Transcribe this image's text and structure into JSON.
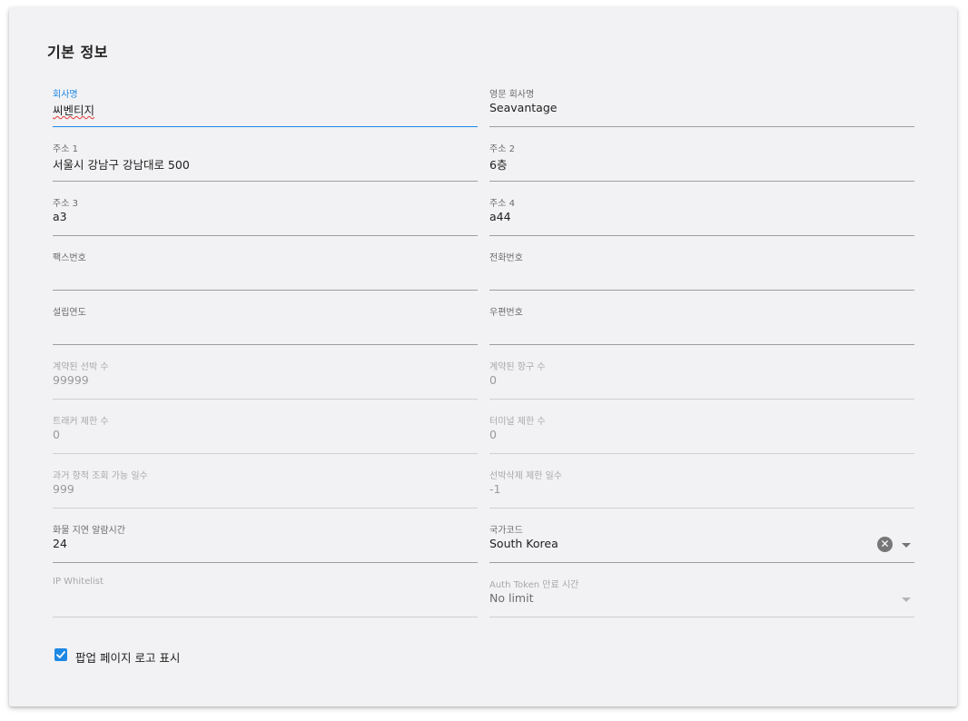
{
  "section": {
    "title": "기본 정보"
  },
  "fields": {
    "company_name": {
      "label": "회사명",
      "value": "씨벤티지"
    },
    "company_name_en": {
      "label": "영문 회사명",
      "value": "Seavantage"
    },
    "address1": {
      "label": "주소 1",
      "value": "서울시 강남구 강남대로 500"
    },
    "address2": {
      "label": "주소 2",
      "value": "6층"
    },
    "address3": {
      "label": "주소 3",
      "value": "a3"
    },
    "address4": {
      "label": "주소 4",
      "value": "a44"
    },
    "fax": {
      "label": "팩스번호",
      "value": ""
    },
    "phone": {
      "label": "전화번호",
      "value": ""
    },
    "founded_year": {
      "label": "설립연도",
      "value": ""
    },
    "postal_code": {
      "label": "우편번호",
      "value": ""
    },
    "contracted_vessels": {
      "label": "계약된 선박 수",
      "value": "99999"
    },
    "contracted_ports": {
      "label": "계약된 항구 수",
      "value": "0"
    },
    "tracker_limit": {
      "label": "트래커 제한 수",
      "value": "0"
    },
    "terminal_limit": {
      "label": "터미널 제한 수",
      "value": "0"
    },
    "history_days": {
      "label": "과거 항적 조회 가능 일수",
      "value": "999"
    },
    "vessel_delete_days": {
      "label": "선박삭제 제한 일수",
      "value": "-1"
    },
    "cargo_delay_alert": {
      "label": "화물 지연 알람시간",
      "value": "24"
    },
    "country_code": {
      "label": "국가코드",
      "value": "South Korea"
    },
    "ip_whitelist": {
      "label": "IP Whitelist",
      "value": ""
    },
    "auth_token_expiry": {
      "label": "Auth Token 만료 시간",
      "value": "No limit"
    }
  },
  "popup_logo": {
    "label": "팝업 페이지 로고 표시",
    "checked": true
  },
  "icons": {
    "clear": "clear-circle-icon",
    "dropdown": "triangle-down-icon",
    "check": "checkmark-icon"
  },
  "colors": {
    "accent": "#1e88e5",
    "spellcheck": "#e53935",
    "panel": "#f2f2f4"
  }
}
